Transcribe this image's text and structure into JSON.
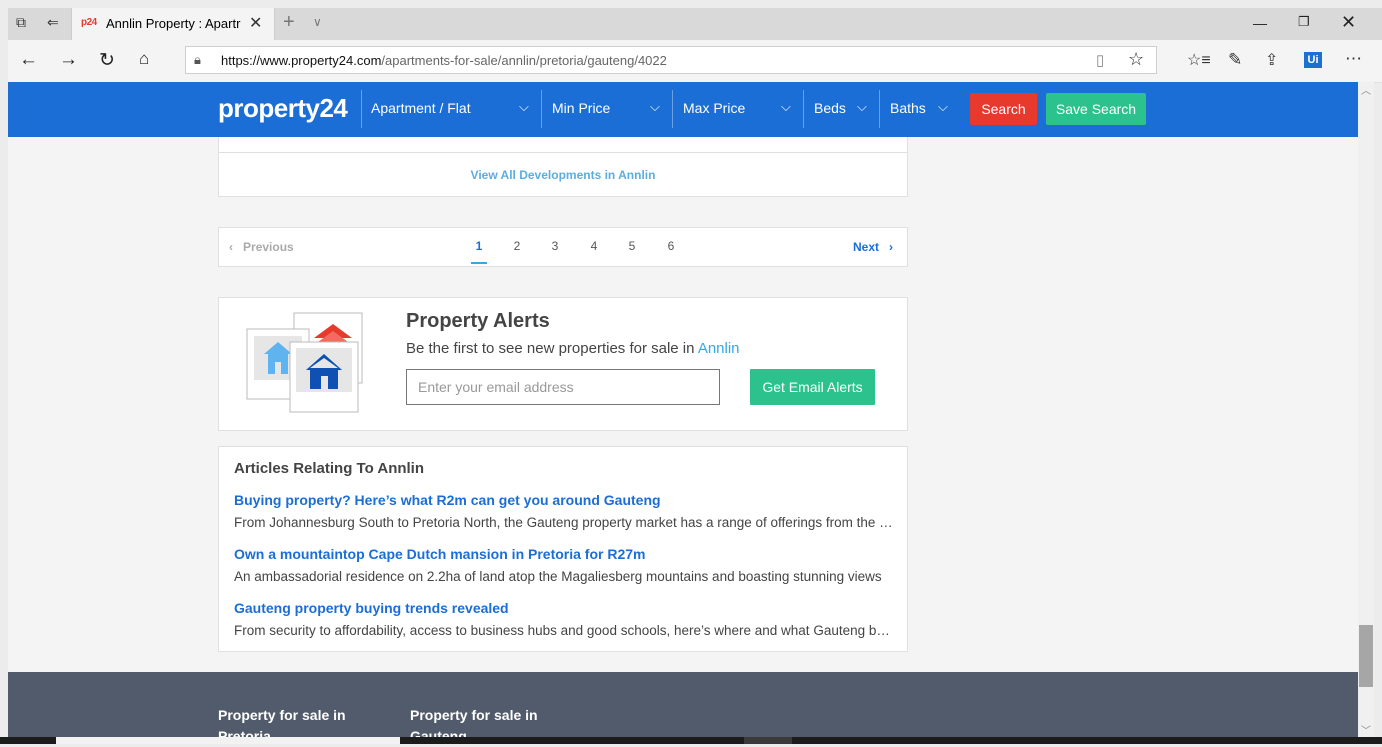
{
  "browser": {
    "tab_title": "Annlin Property : Apartr",
    "favicon_text": "p24",
    "url_domain": "https://www.property24.com",
    "url_path": "/apartments-for-sale/annlin/pretoria/gauteng/4022",
    "profile_badge": "Ui"
  },
  "header": {
    "logo": "property24",
    "filters": {
      "type": "Apartment / Flat",
      "min_price": "Min Price",
      "max_price": "Max Price",
      "beds": "Beds",
      "baths": "Baths"
    },
    "search_label": "Search",
    "save_search_label": "Save Search"
  },
  "developments": {
    "link": "View All Developments in Annlin"
  },
  "pagination": {
    "previous": "Previous",
    "next": "Next",
    "pages": [
      "1",
      "2",
      "3",
      "4",
      "5",
      "6"
    ],
    "current": "1"
  },
  "alerts": {
    "title": "Property Alerts",
    "subtitle_prefix": "Be the first to see new properties for sale in",
    "subtitle_place": "Annlin",
    "email_placeholder": "Enter your email address",
    "button": "Get Email Alerts"
  },
  "articles": {
    "title": "Articles Relating To Annlin",
    "items": [
      {
        "title": "Buying property? Here’s what R2m can get you around Gauteng",
        "desc": "From Johannesburg South to Pretoria North, the Gauteng property market has a range of offerings from the affordable to the luxurious"
      },
      {
        "title": "Own a mountaintop Cape Dutch mansion in Pretoria for R27m",
        "desc": "An ambassadorial residence on 2.2ha of land atop the Magaliesberg mountains and boasting stunning views"
      },
      {
        "title": "Gauteng property buying trends revealed",
        "desc": "From security to affordability, access to business hubs and good schools, here’s where and what Gauteng buyers want"
      }
    ]
  },
  "footer": {
    "col1": "Property for sale in Pretoria",
    "col2": "Property for sale in Gauteng"
  },
  "colors": {
    "brand_blue": "#1a6ed6",
    "search_red": "#e8392d",
    "accent_green": "#2cc28e",
    "footer_gray": "#525b6b"
  }
}
